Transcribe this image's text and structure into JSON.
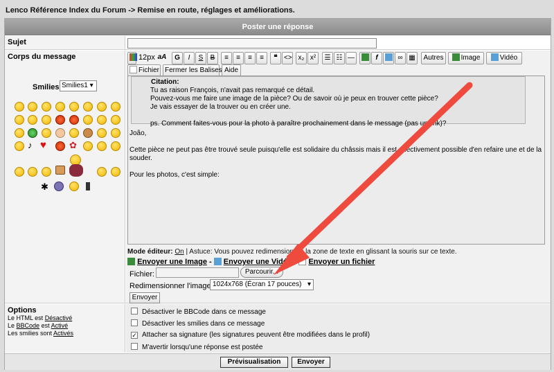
{
  "breadcrumb": "Lenco Référence Index du Forum -> Remise en route, réglages et améliorations.",
  "header_title": "Poster une réponse",
  "subject": {
    "label": "Sujet",
    "value": ""
  },
  "body": {
    "label": "Corps du message"
  },
  "toolbar": {
    "size_label": "12px",
    "aa_label": "aA",
    "bold": "G",
    "italic": "I",
    "underline": "S",
    "strike": "B",
    "quote": "❝",
    "code": "<>",
    "sub": "x₂",
    "sup": "x²",
    "autres": "Autres",
    "image": "Image",
    "video": "Vidéo",
    "fichier": "Fichier",
    "close_tags": "Fermer les Balises",
    "aide": "Aide"
  },
  "smilies": {
    "label": "Smilies:",
    "selected": "Smilies1"
  },
  "editor": {
    "quote_title": "Citation:",
    "quote_lines": [
      "Tu as raison François, n'avait pas remarqué ce détail.",
      "Pouvez-vous me faire une image de la pièce? Ou de savoir où je peux en trouver cette pièce?",
      "Je vais essayer de la trouver ou en créer une.",
      "",
      "ps. Comment faites-vous pour la photo à paraître prochainement dans le message (pas un link)?"
    ],
    "greeting": "João,",
    "para1": "Cette pièce ne peut pas être trouvé seule puisqu'elle est solidaire du châssis mais il est effectivement possible d'en refaire une et de la souder.",
    "para2": "Pour les photos, c'est simple:"
  },
  "mode_line": {
    "prefix": "Mode éditeur:",
    "on": "On",
    "rest": "| Astuce: Vous pouvez redimensionner la zone de texte en glissant la souris sur ce texte."
  },
  "send_links": {
    "image": "Envoyer une Image",
    "sep1": " - ",
    "video": "Envoyer une Vidéo",
    "sep2": " - ",
    "file": "Envoyer un fichier"
  },
  "upload": {
    "file_label": "Fichier:",
    "browse": "Parcourir...",
    "resize_label": "Redimensionner l'image ?",
    "resize_value": "1024x768 (Écran 17 pouces)",
    "send": "Envoyer"
  },
  "options": {
    "title": "Options",
    "html_prefix": "Le HTML est",
    "html_state": "Désactivé",
    "bbcode_prefix": "Le",
    "bbcode_link": "BBCode",
    "bbcode_mid": "est",
    "bbcode_state": "Activé",
    "smilies_prefix": "Les smilies sont",
    "smilies_state": "Activés",
    "checkboxes": [
      {
        "label": "Désactiver le BBCode dans ce message",
        "checked": false
      },
      {
        "label": "Désactiver les smilies dans ce message",
        "checked": false
      },
      {
        "label": "Attacher sa signature (les signatures peuvent être modifiées dans le profil)",
        "checked": true
      },
      {
        "label": "M'avertir lorsqu'une réponse est postée",
        "checked": false
      }
    ]
  },
  "footer": {
    "preview": "Prévisualisation",
    "send": "Envoyer"
  },
  "colors": {
    "arrow": "#ee4a3e",
    "header": "#999999"
  }
}
